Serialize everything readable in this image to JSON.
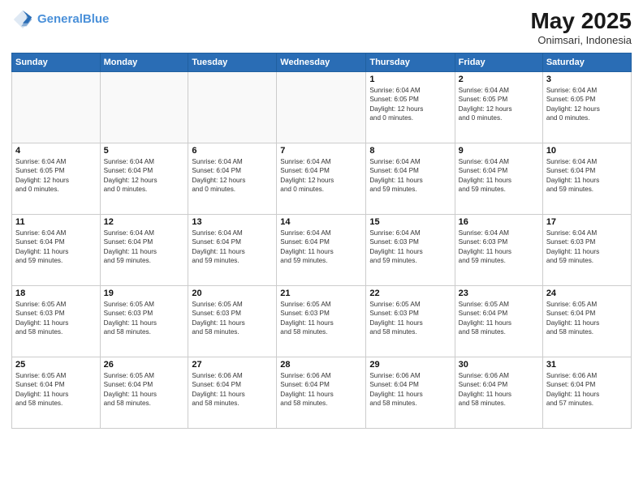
{
  "header": {
    "logo_line1": "General",
    "logo_line2": "Blue",
    "month": "May 2025",
    "location": "Onimsari, Indonesia"
  },
  "days_of_week": [
    "Sunday",
    "Monday",
    "Tuesday",
    "Wednesday",
    "Thursday",
    "Friday",
    "Saturday"
  ],
  "weeks": [
    [
      {
        "day": "",
        "info": ""
      },
      {
        "day": "",
        "info": ""
      },
      {
        "day": "",
        "info": ""
      },
      {
        "day": "",
        "info": ""
      },
      {
        "day": "1",
        "info": "Sunrise: 6:04 AM\nSunset: 6:05 PM\nDaylight: 12 hours\nand 0 minutes."
      },
      {
        "day": "2",
        "info": "Sunrise: 6:04 AM\nSunset: 6:05 PM\nDaylight: 12 hours\nand 0 minutes."
      },
      {
        "day": "3",
        "info": "Sunrise: 6:04 AM\nSunset: 6:05 PM\nDaylight: 12 hours\nand 0 minutes."
      }
    ],
    [
      {
        "day": "4",
        "info": "Sunrise: 6:04 AM\nSunset: 6:05 PM\nDaylight: 12 hours\nand 0 minutes."
      },
      {
        "day": "5",
        "info": "Sunrise: 6:04 AM\nSunset: 6:04 PM\nDaylight: 12 hours\nand 0 minutes."
      },
      {
        "day": "6",
        "info": "Sunrise: 6:04 AM\nSunset: 6:04 PM\nDaylight: 12 hours\nand 0 minutes."
      },
      {
        "day": "7",
        "info": "Sunrise: 6:04 AM\nSunset: 6:04 PM\nDaylight: 12 hours\nand 0 minutes."
      },
      {
        "day": "8",
        "info": "Sunrise: 6:04 AM\nSunset: 6:04 PM\nDaylight: 11 hours\nand 59 minutes."
      },
      {
        "day": "9",
        "info": "Sunrise: 6:04 AM\nSunset: 6:04 PM\nDaylight: 11 hours\nand 59 minutes."
      },
      {
        "day": "10",
        "info": "Sunrise: 6:04 AM\nSunset: 6:04 PM\nDaylight: 11 hours\nand 59 minutes."
      }
    ],
    [
      {
        "day": "11",
        "info": "Sunrise: 6:04 AM\nSunset: 6:04 PM\nDaylight: 11 hours\nand 59 minutes."
      },
      {
        "day": "12",
        "info": "Sunrise: 6:04 AM\nSunset: 6:04 PM\nDaylight: 11 hours\nand 59 minutes."
      },
      {
        "day": "13",
        "info": "Sunrise: 6:04 AM\nSunset: 6:04 PM\nDaylight: 11 hours\nand 59 minutes."
      },
      {
        "day": "14",
        "info": "Sunrise: 6:04 AM\nSunset: 6:04 PM\nDaylight: 11 hours\nand 59 minutes."
      },
      {
        "day": "15",
        "info": "Sunrise: 6:04 AM\nSunset: 6:03 PM\nDaylight: 11 hours\nand 59 minutes."
      },
      {
        "day": "16",
        "info": "Sunrise: 6:04 AM\nSunset: 6:03 PM\nDaylight: 11 hours\nand 59 minutes."
      },
      {
        "day": "17",
        "info": "Sunrise: 6:04 AM\nSunset: 6:03 PM\nDaylight: 11 hours\nand 59 minutes."
      }
    ],
    [
      {
        "day": "18",
        "info": "Sunrise: 6:05 AM\nSunset: 6:03 PM\nDaylight: 11 hours\nand 58 minutes."
      },
      {
        "day": "19",
        "info": "Sunrise: 6:05 AM\nSunset: 6:03 PM\nDaylight: 11 hours\nand 58 minutes."
      },
      {
        "day": "20",
        "info": "Sunrise: 6:05 AM\nSunset: 6:03 PM\nDaylight: 11 hours\nand 58 minutes."
      },
      {
        "day": "21",
        "info": "Sunrise: 6:05 AM\nSunset: 6:03 PM\nDaylight: 11 hours\nand 58 minutes."
      },
      {
        "day": "22",
        "info": "Sunrise: 6:05 AM\nSunset: 6:03 PM\nDaylight: 11 hours\nand 58 minutes."
      },
      {
        "day": "23",
        "info": "Sunrise: 6:05 AM\nSunset: 6:04 PM\nDaylight: 11 hours\nand 58 minutes."
      },
      {
        "day": "24",
        "info": "Sunrise: 6:05 AM\nSunset: 6:04 PM\nDaylight: 11 hours\nand 58 minutes."
      }
    ],
    [
      {
        "day": "25",
        "info": "Sunrise: 6:05 AM\nSunset: 6:04 PM\nDaylight: 11 hours\nand 58 minutes."
      },
      {
        "day": "26",
        "info": "Sunrise: 6:05 AM\nSunset: 6:04 PM\nDaylight: 11 hours\nand 58 minutes."
      },
      {
        "day": "27",
        "info": "Sunrise: 6:06 AM\nSunset: 6:04 PM\nDaylight: 11 hours\nand 58 minutes."
      },
      {
        "day": "28",
        "info": "Sunrise: 6:06 AM\nSunset: 6:04 PM\nDaylight: 11 hours\nand 58 minutes."
      },
      {
        "day": "29",
        "info": "Sunrise: 6:06 AM\nSunset: 6:04 PM\nDaylight: 11 hours\nand 58 minutes."
      },
      {
        "day": "30",
        "info": "Sunrise: 6:06 AM\nSunset: 6:04 PM\nDaylight: 11 hours\nand 58 minutes."
      },
      {
        "day": "31",
        "info": "Sunrise: 6:06 AM\nSunset: 6:04 PM\nDaylight: 11 hours\nand 57 minutes."
      }
    ]
  ]
}
